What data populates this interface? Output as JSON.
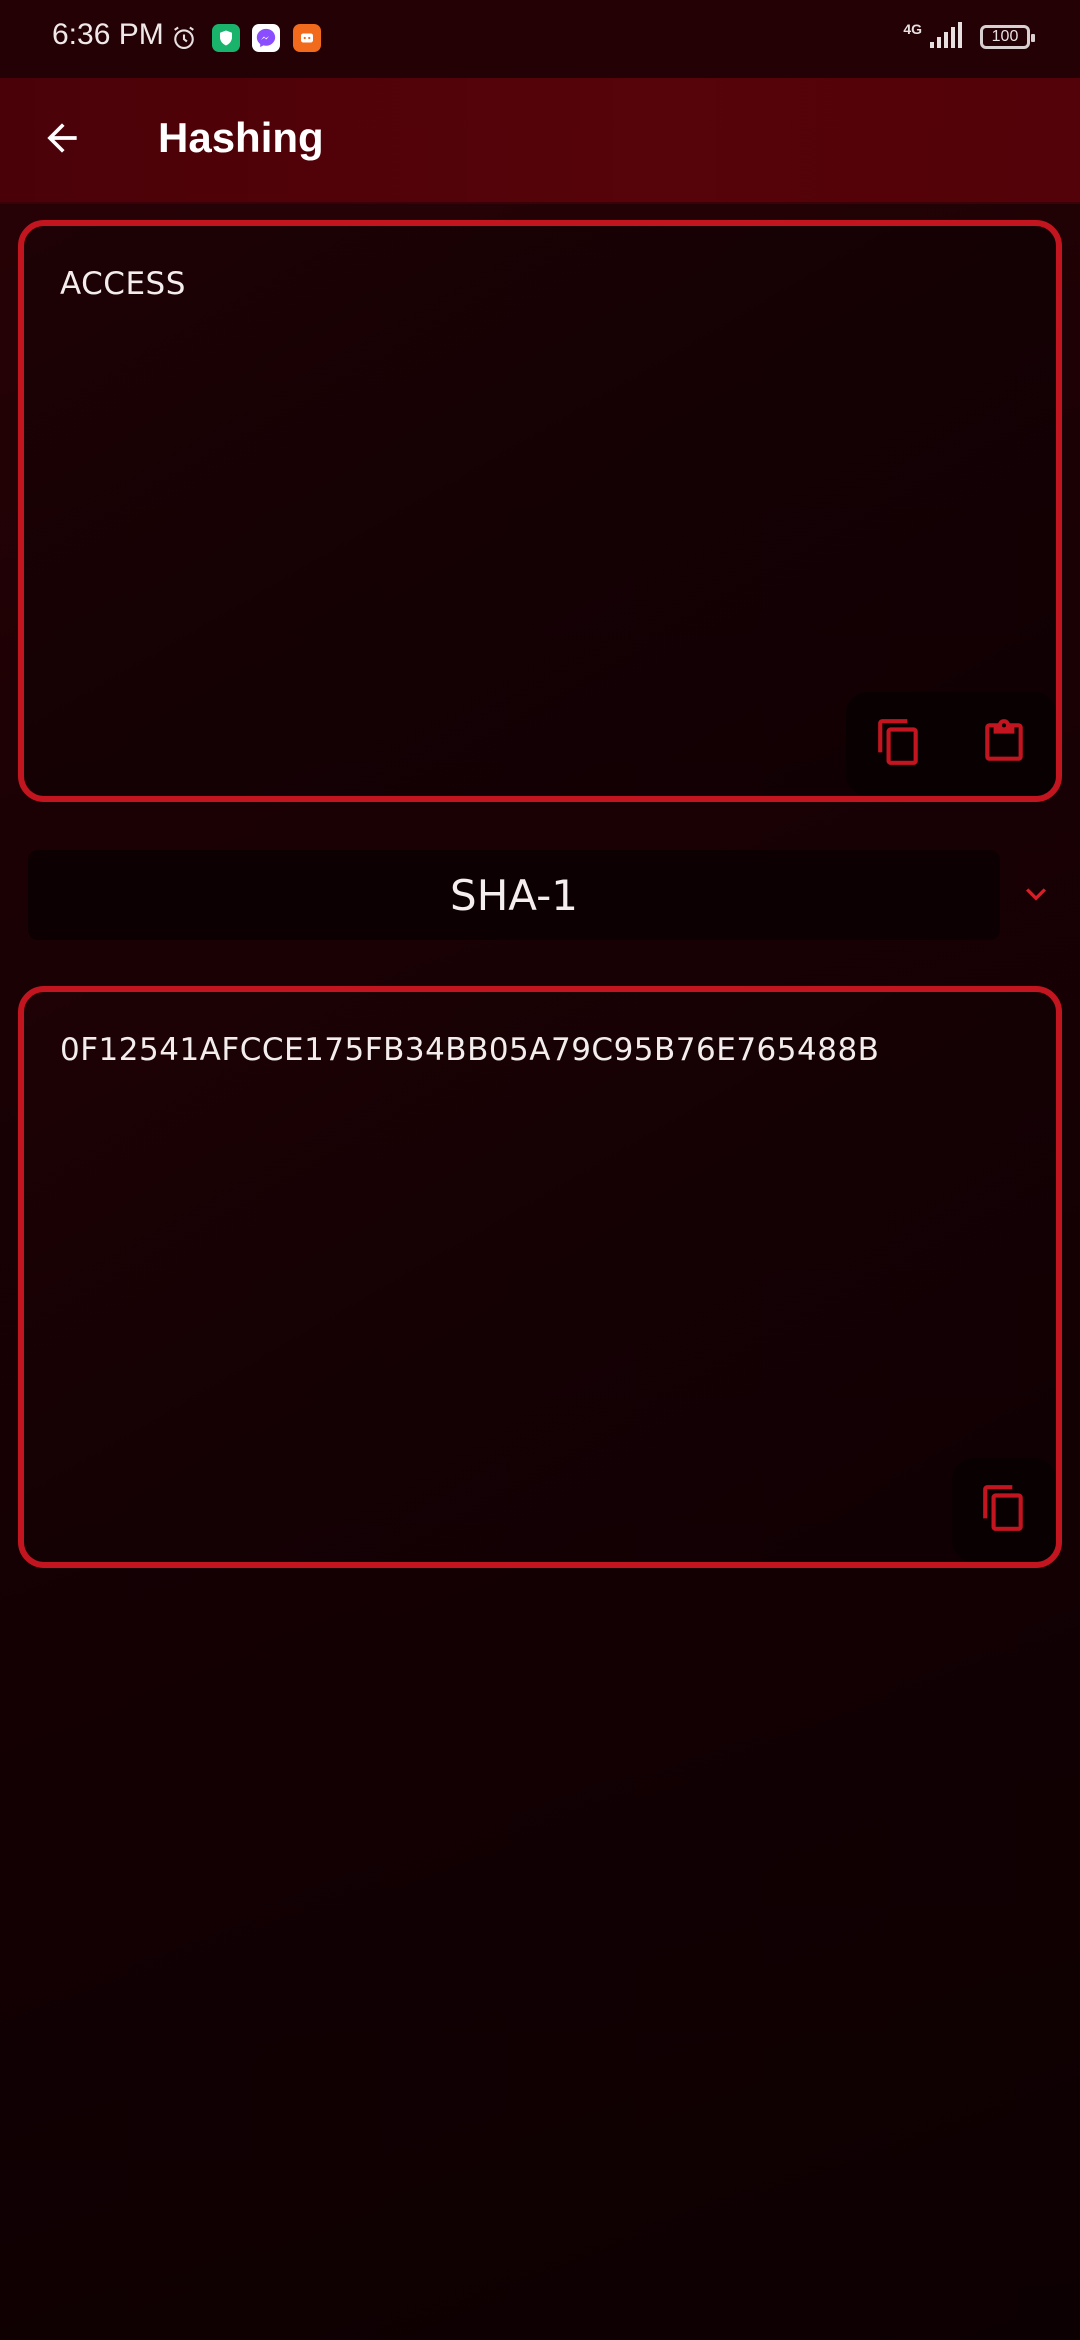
{
  "status_bar": {
    "time": "6:36 PM",
    "network": "4G",
    "battery": "100"
  },
  "app_bar": {
    "title": "Hashing"
  },
  "input_box": {
    "value": "ACCESS"
  },
  "algorithm": {
    "selected": "SHA-1"
  },
  "output_box": {
    "value": "0F12541AFCCE175FB34BB05A79C95B76E765488B"
  },
  "colors": {
    "accent": "#c3151f",
    "app_bar": "#560309",
    "background": "#120003"
  }
}
